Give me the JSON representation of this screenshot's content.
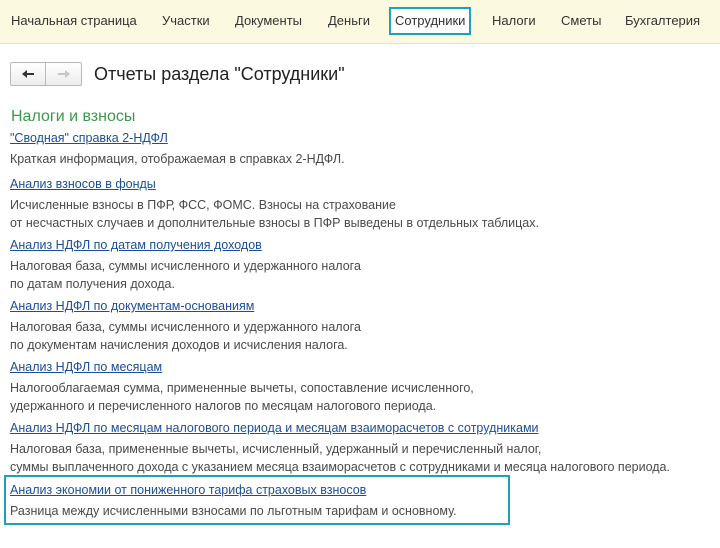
{
  "nav": {
    "items": [
      {
        "label": "Начальная страница"
      },
      {
        "label": "Участки"
      },
      {
        "label": "Документы"
      },
      {
        "label": "Деньги"
      },
      {
        "label": "Сотрудники",
        "active": true
      },
      {
        "label": "Налоги"
      },
      {
        "label": "Сметы"
      },
      {
        "label": "Бухгалтерия"
      }
    ]
  },
  "header": {
    "back_icon": "arrow-left-icon",
    "forward_icon": "arrow-right-icon",
    "title": "Отчеты раздела \"Сотрудники\""
  },
  "section": {
    "title": "Налоги и взносы"
  },
  "reports": [
    {
      "link": "\"Сводная\" справка 2-НДФЛ",
      "desc": "Краткая информация, отображаемая в справках 2-НДФЛ."
    },
    {
      "link": "Анализ взносов в фонды",
      "desc": "Исчисленные взносы в ПФР, ФСС, ФОМС. Взносы на страхование\nот несчастных случаев и дополнительные взносы в ПФР выведены в отдельных таблицах."
    },
    {
      "link": "Анализ НДФЛ по датам получения доходов",
      "desc": "Налоговая база, суммы исчисленного и удержанного налога\nпо датам получения дохода."
    },
    {
      "link": "Анализ НДФЛ по документам-основаниям",
      "desc": "Налоговая база, суммы исчисленного и удержанного налога\nпо документам начисления доходов и исчисления налога."
    },
    {
      "link": "Анализ НДФЛ по месяцам",
      "desc": "Налогооблагаемая сумма, примененные вычеты, сопоставление исчисленного,\nудержанного и перечисленного налогов по месяцам налогового периода."
    },
    {
      "link": "Анализ НДФЛ по месяцам налогового периода и месяцам взаиморасчетов с сотрудниками",
      "desc": "Налоговая база, примененные вычеты, исчисленный, удержанный и перечисленный налог,\nсуммы выплаченного дохода с указанием месяца взаиморасчетов с сотрудниками и месяца налогового периода."
    },
    {
      "link": "Анализ экономии от пониженного тарифа страховых взносов",
      "desc": "Разница между исчисленными взносами по льготным тарифам и основному."
    }
  ]
}
